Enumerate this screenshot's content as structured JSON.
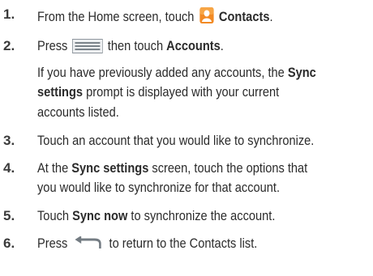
{
  "steps": [
    {
      "number": "1.",
      "lines": [
        {
          "a": "From the Home screen, touch",
          "icon": "contacts-app-icon",
          "b_bold": "Contacts",
          "c": "."
        }
      ]
    },
    {
      "number": "2.",
      "lines": [
        {
          "a": "Press",
          "icon": "menu-key-icon",
          "b": "then touch",
          "c_bold": "Accounts",
          "d": "."
        }
      ],
      "note": {
        "l1_a": "If you have previously added any accounts, the",
        "l1_bold": "Sync",
        "l2_bold": "settings",
        "l2_b": "prompt is displayed with your current",
        "l3": "accounts listed."
      }
    },
    {
      "number": "3.",
      "text": "Touch an account that you would like to synchronize."
    },
    {
      "number": "4.",
      "l1_a": "At the",
      "l1_bold": "Sync settings",
      "l1_b": "screen, touch the options that",
      "l2": "you would like to synchronize for that account."
    },
    {
      "number": "5.",
      "a": "Touch",
      "bold": "Sync now",
      "b": "to synchronize the account."
    },
    {
      "number": "6.",
      "a": "Press",
      "icon": "back-key-icon",
      "b": "to return to the Contacts list."
    }
  ]
}
